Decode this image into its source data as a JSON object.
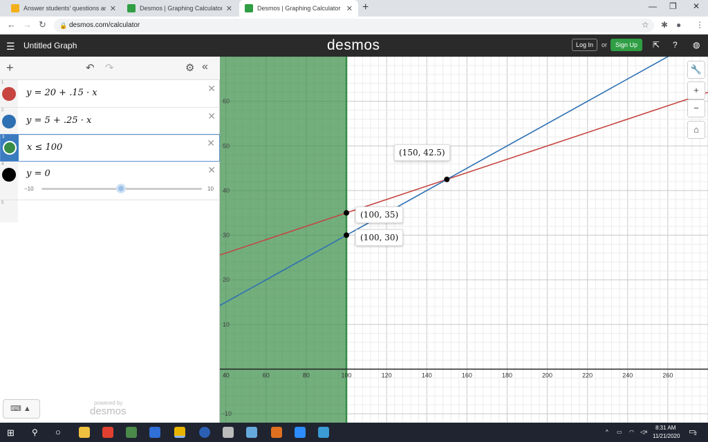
{
  "browser": {
    "tabs": [
      {
        "title": "Answer students' questions and"
      },
      {
        "title": "Desmos | Graphing Calculator"
      },
      {
        "title": "Desmos | Graphing Calculator"
      }
    ],
    "url": "desmos.com/calculator"
  },
  "app": {
    "graph_title": "Untitled Graph",
    "logo": "desmos",
    "login_label": "Log In",
    "or_label": "or",
    "signup_label": "Sign Up",
    "powered_by": "powered by",
    "powered_logo": "desmos"
  },
  "expressions": [
    {
      "index": "1",
      "latex": "y = 20 + .15 · x",
      "color": "#c74440"
    },
    {
      "index": "2",
      "latex": "y = 5 + .25 · x",
      "color": "#2d70b3"
    },
    {
      "index": "3",
      "latex": "x ≤ 100",
      "color": "#388c46"
    },
    {
      "index": "4",
      "latex": "y = 0",
      "color": "#000000",
      "slider_min": "−10",
      "slider_max": "10"
    },
    {
      "index": "5",
      "latex": ""
    }
  ],
  "chart_data": {
    "type": "line",
    "x_range": [
      37,
      280
    ],
    "y_range": [
      -12,
      70
    ],
    "x_ticks": [
      40,
      60,
      80,
      100,
      120,
      140,
      160,
      180,
      200,
      220,
      240,
      260
    ],
    "y_ticks": [
      -10,
      10,
      20,
      30,
      40,
      50,
      60
    ],
    "series": [
      {
        "expr": "y = 20 + .15 · x",
        "intercept": 20,
        "slope": 0.15,
        "color": "#c74440"
      },
      {
        "expr": "y = 5 + .25 · x",
        "intercept": 5,
        "slope": 0.25,
        "color": "#2d70b3"
      }
    ],
    "inequality": {
      "expr": "x ≤ 100",
      "boundary": 100,
      "color": "#388c46"
    },
    "points": [
      {
        "x": 150,
        "y": 42.5,
        "label": "(150, 42.5)"
      },
      {
        "x": 100,
        "y": 35,
        "label": "(100, 35)"
      },
      {
        "x": 100,
        "y": 30,
        "label": "(100, 30)"
      }
    ]
  },
  "taskbar": {
    "time": "8:31 AM",
    "date": "11/21/2020",
    "notifications": "2"
  }
}
